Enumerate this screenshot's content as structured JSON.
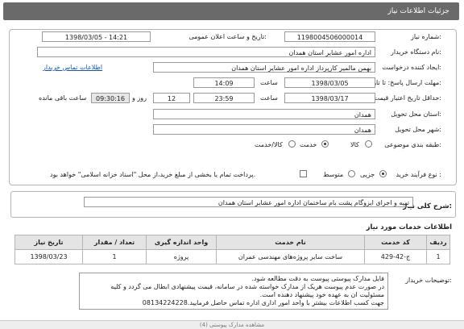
{
  "header": {
    "title": "جزئیات اطلاعات نیاز"
  },
  "form": {
    "need_number_label": "شماره نیاز:",
    "need_number_value": "1198004506000014",
    "announce_datetime_label": "تاریخ و ساعت اعلان عمومی:",
    "announce_datetime_value": "1398/03/05 - 14:21",
    "buyer_org_label": "نام دستگاه خریدار:",
    "buyer_org_value": "اداره امور عشایر استان همدان",
    "creator_label": "ایجاد کننده درخواست:",
    "creator_value": "بهمن  مالمیر کارپرداز اداره امور عشایر استان همدان",
    "contact_link": "اطلاعات تماس خریدار",
    "send_deadline_label": "مهلت ارسال پاسخ: تا تاریخ:",
    "send_deadline_date": "1398/03/05",
    "send_time_label": "ساعت",
    "send_time_value": "14:09",
    "validity_label": "حداقل تاریخ اعتبار قیمت: تا تاریخ:",
    "validity_date": "1398/03/17",
    "validity_time_label": "ساعت",
    "validity_time_value": "23:59",
    "days_value": "12",
    "days_label": "روز و",
    "remaining_value": "09:30:16",
    "remaining_label": "ساعت باقی مانده",
    "province_label": "استان محل تحویل:",
    "province_value": "همدان",
    "city_label": "شهر محل تحویل:",
    "city_value": "همدان",
    "category_label": "طبقه بندی موضوعی:",
    "category_options": [
      "کالا",
      "خدمت",
      "کالا/خدمت"
    ],
    "category_selected": "خدمت",
    "process_label": "نوع فرآیند خرید :",
    "process_options": [
      "جزیی",
      "متوسط"
    ],
    "process_selected": "جزیی",
    "payment_note": "پرداخت تمام یا بخشی از مبلغ خرید،از محل \"اسناد خزانه اسلامی\" خواهد بود."
  },
  "description": {
    "label": "شرح کلی نیاز:",
    "value": "تهیه و اجرای ایزوگام پشت بام ساختمان اداره امور عشایر استان همدان"
  },
  "services": {
    "title": "اطلاعات خدمات مورد نیاز",
    "columns": [
      "ردیف",
      "کد خدمت",
      "نام خدمت",
      "واحد اندازه گیری",
      "تعداد / مقدار",
      "تاریخ نیاز"
    ],
    "rows": [
      {
        "row": "1",
        "code": "ج-42-429",
        "name": "ساخت سایر پروژه‌های مهندسی عمران",
        "unit": "پروژه",
        "qty": "1",
        "date": "1398/03/23"
      }
    ]
  },
  "notes": {
    "label": "توضیحات خریدار:",
    "lines": [
      "فایل مدارک پیوستی پیوست به دقت مطالعه شود.",
      "در صورت عدم پیوست هریک از مدارک خواسته شده در سامانه، قیمت پیشنهادی ابطال می گردد و کلیه",
      "مسئولیت ان به عهده خود پیشنهاد دهنده است.",
      "جهت کسب اطلاعات بیشتر با واحد امور اداری اداره تماس حاصل فرمایید.08134224228"
    ]
  },
  "footer": {
    "text": "مشاهده مدارک پیوستی (4)"
  }
}
